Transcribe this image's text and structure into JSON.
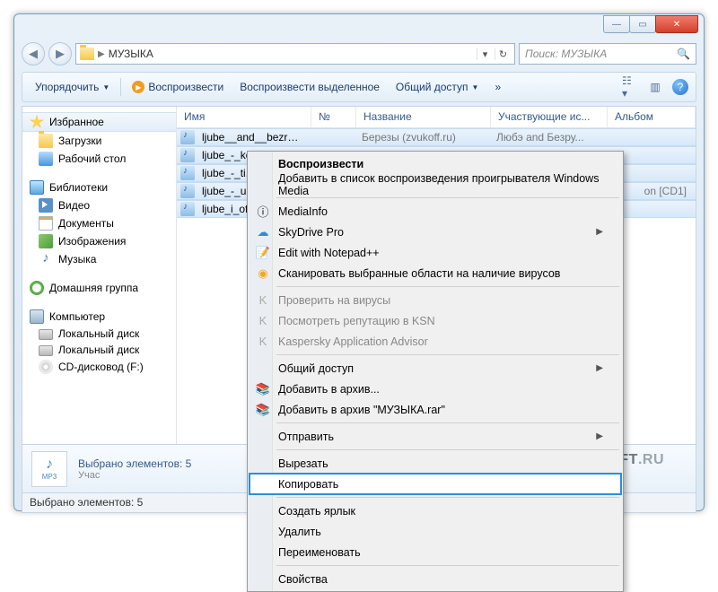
{
  "breadcrumb": {
    "root_icon": "folder",
    "folder": "МУЗЫКА"
  },
  "search": {
    "placeholder": "Поиск: МУЗЫКА"
  },
  "toolbar": {
    "organize": "Упорядочить",
    "play": "Воспроизвести",
    "play_selected": "Воспроизвести выделенное",
    "share": "Общий доступ"
  },
  "sidebar": {
    "favorites": {
      "label": "Избранное",
      "items": [
        {
          "label": "Загрузки",
          "icon": "folder"
        },
        {
          "label": "Рабочий стол",
          "icon": "desktop"
        }
      ]
    },
    "libraries": {
      "label": "Библиотеки",
      "items": [
        {
          "label": "Видео",
          "icon": "video"
        },
        {
          "label": "Документы",
          "icon": "document"
        },
        {
          "label": "Изображения",
          "icon": "image"
        },
        {
          "label": "Музыка",
          "icon": "music"
        }
      ]
    },
    "homegroup": {
      "label": "Домашняя группа"
    },
    "computer": {
      "label": "Компьютер",
      "items": [
        {
          "label": "Локальный диск",
          "icon": "disk"
        },
        {
          "label": "Локальный диск",
          "icon": "disk"
        },
        {
          "label": "CD-дисковод (F:)",
          "icon": "cd"
        }
      ]
    }
  },
  "columns": {
    "name": "Имя",
    "no": "№",
    "title": "Название",
    "artists": "Участвующие ис...",
    "album": "Альбом"
  },
  "files": [
    {
      "name": "ljube__and__bezruk...",
      "title": "Березы (zvukoff.ru)",
      "artists": "Любэ  and  Безру...",
      "album": ""
    },
    {
      "name": "ljube_-_ko...",
      "title": "",
      "artists": "",
      "album": ""
    },
    {
      "name": "ljube_-_ti...",
      "title": "",
      "artists": "",
      "album": ""
    },
    {
      "name": "ljube_-_uh...",
      "title": "",
      "artists": "",
      "album": "on [CD1]"
    },
    {
      "name": "ljube_i_ofi...",
      "title": "",
      "artists": "",
      "album": ""
    }
  ],
  "details": {
    "selected": "Выбрано элементов: 5",
    "sub": "Учас"
  },
  "status": {
    "text": "Выбрано элементов: 5"
  },
  "context_menu": {
    "play": "Воспроизвести",
    "add_wmp": "Добавить в список воспроизведения проигрывателя Windows Media",
    "mediainfo": "MediaInfo",
    "skydrive": "SkyDrive Pro",
    "notepad": "Edit with Notepad++",
    "scan_virus": "Сканировать выбранные области на наличие вирусов",
    "check_virus": "Проверить на вирусы",
    "ksn": "Посмотреть репутацию в KSN",
    "kaspersky": "Kaspersky Application Advisor",
    "share": "Общий доступ",
    "add_archive": "Добавить в архив...",
    "add_rar": "Добавить в архив \"МУЗЫКА.rar\"",
    "send_to": "Отправить",
    "cut": "Вырезать",
    "copy": "Копировать",
    "shortcut": "Создать ярлык",
    "delete": "Удалить",
    "rename": "Переименовать",
    "properties": "Свойства"
  },
  "watermark": {
    "site": "FREESOFT",
    "tld": ".RU"
  },
  "thumb_label": "MP3"
}
